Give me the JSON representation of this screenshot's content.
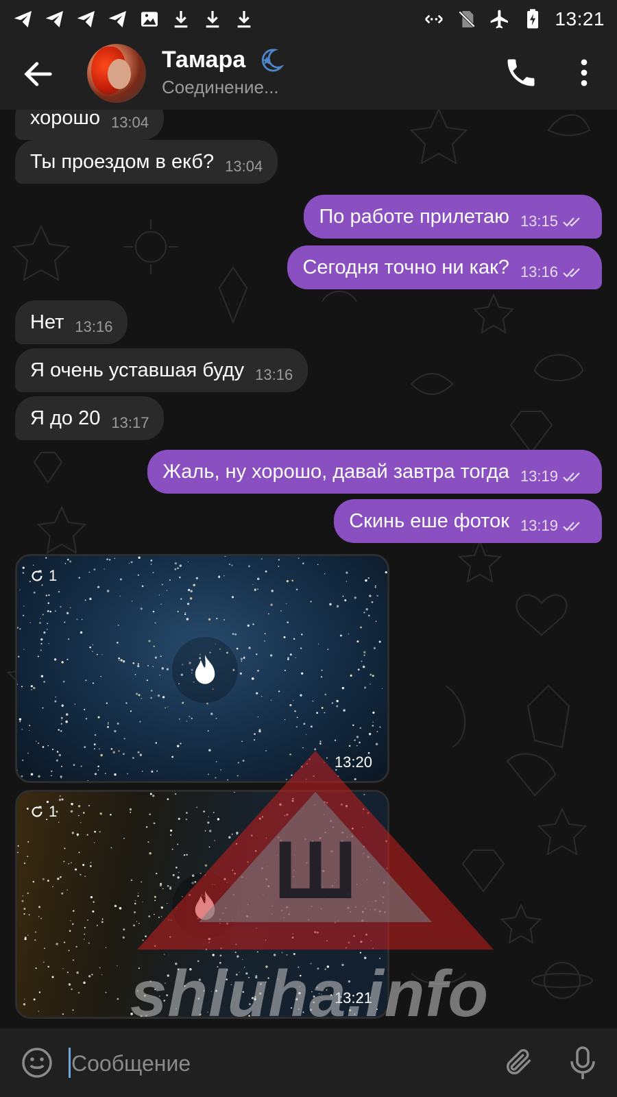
{
  "status_bar": {
    "time": "13:21"
  },
  "header": {
    "name": "Тамара",
    "status": "Соединение..."
  },
  "messages": [
    {
      "dir": "in",
      "text": "хорошо",
      "time": "13:04"
    },
    {
      "dir": "in",
      "text": "Ты проездом в екб?",
      "time": "13:04"
    },
    {
      "dir": "out",
      "text": "По работе прилетаю",
      "time": "13:15",
      "read": true
    },
    {
      "dir": "out",
      "text": "Сегодня точно ни как?",
      "time": "13:16",
      "read": true
    },
    {
      "dir": "in",
      "text": "Нет",
      "time": "13:16"
    },
    {
      "dir": "in",
      "text": "Я очень уставшая буду",
      "time": "13:16"
    },
    {
      "dir": "in",
      "text": "Я до 20",
      "time": "13:17"
    },
    {
      "dir": "out",
      "text": "Жаль, ну хорошо, давай завтра тогда",
      "time": "13:19",
      "read": true
    },
    {
      "dir": "out",
      "text": "Скинь еше фоток",
      "time": "13:19",
      "read": true
    }
  ],
  "photos": [
    {
      "views": "1",
      "time": "13:20",
      "icon": "fire-icon"
    },
    {
      "views": "1",
      "time": "13:21",
      "icon": "fire-icon"
    }
  ],
  "watermark": {
    "text": "shluha.info",
    "glyph": "Ш"
  },
  "composer": {
    "placeholder": "Сообщение"
  },
  "colors": {
    "outgoing_bubble": "#8a4fc1",
    "incoming_bubble": "#2a2a2a",
    "bars": "#202020",
    "background": "#141414"
  }
}
